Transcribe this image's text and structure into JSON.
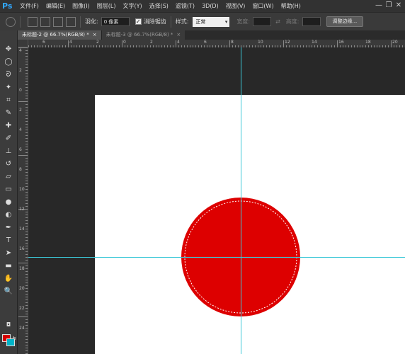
{
  "app": {
    "logo": "Ps"
  },
  "menu": [
    "文件(F)",
    "编辑(E)",
    "图像(I)",
    "图层(L)",
    "文字(Y)",
    "选择(S)",
    "滤镜(T)",
    "3D(D)",
    "视图(V)",
    "窗口(W)",
    "帮助(H)"
  ],
  "window_controls": {
    "minimize": "—",
    "restore": "❐",
    "close": "✕"
  },
  "options": {
    "feather_label": "羽化:",
    "feather_value": "0 像素",
    "antialias_label": "消除锯齿",
    "antialias_checked": true,
    "style_label": "样式:",
    "style_value": "正常",
    "width_label": "宽度:",
    "height_label": "高度:",
    "swap_icon": "⇄",
    "refine_button": "调整边缘..."
  },
  "tabs": [
    {
      "label": "未标题-2 @ 66.7%(RGB/8) *",
      "close": "×",
      "active": true
    },
    {
      "label": "未标题-3 @ 66.7%(RGB/8) *",
      "close": "×",
      "active": false
    }
  ],
  "tools": [
    {
      "name": "move-tool-icon",
      "glyph": "✥"
    },
    {
      "name": "elliptical-marquee-icon",
      "glyph": "◯"
    },
    {
      "name": "lasso-icon",
      "glyph": "ᘐ"
    },
    {
      "name": "quick-selection-icon",
      "glyph": "✦"
    },
    {
      "name": "crop-icon",
      "glyph": "⌗"
    },
    {
      "name": "eyedropper-icon",
      "glyph": "✎"
    },
    {
      "name": "healing-brush-icon",
      "glyph": "✚"
    },
    {
      "name": "brush-icon",
      "glyph": "✐"
    },
    {
      "name": "clone-stamp-icon",
      "glyph": "⊥"
    },
    {
      "name": "history-brush-icon",
      "glyph": "↺"
    },
    {
      "name": "eraser-icon",
      "glyph": "▱"
    },
    {
      "name": "gradient-icon",
      "glyph": "▭"
    },
    {
      "name": "blur-icon",
      "glyph": "●"
    },
    {
      "name": "dodge-icon",
      "glyph": "◐"
    },
    {
      "name": "pen-icon",
      "glyph": "✒"
    },
    {
      "name": "type-icon",
      "glyph": "T"
    },
    {
      "name": "path-selection-icon",
      "glyph": "➤"
    },
    {
      "name": "rectangle-shape-icon",
      "glyph": "▬"
    },
    {
      "name": "hand-icon",
      "glyph": "✋"
    },
    {
      "name": "zoom-icon",
      "glyph": "🔍"
    }
  ],
  "colors": {
    "foreground": "#d40000",
    "background": "#00b4c8",
    "circle": "#dd0000",
    "guide": "#3cc8d8"
  },
  "ruler": {
    "top_labels": [
      "6",
      "4",
      "2",
      "0",
      "2",
      "4",
      "6",
      "8",
      "10",
      "12",
      "14",
      "16",
      "18",
      "20",
      "22",
      "24",
      "26"
    ],
    "left_labels": [
      "4",
      "2",
      "0",
      "2",
      "4",
      "6",
      "8",
      "10",
      "12",
      "14",
      "16",
      "18",
      "20",
      "22",
      "24"
    ]
  }
}
